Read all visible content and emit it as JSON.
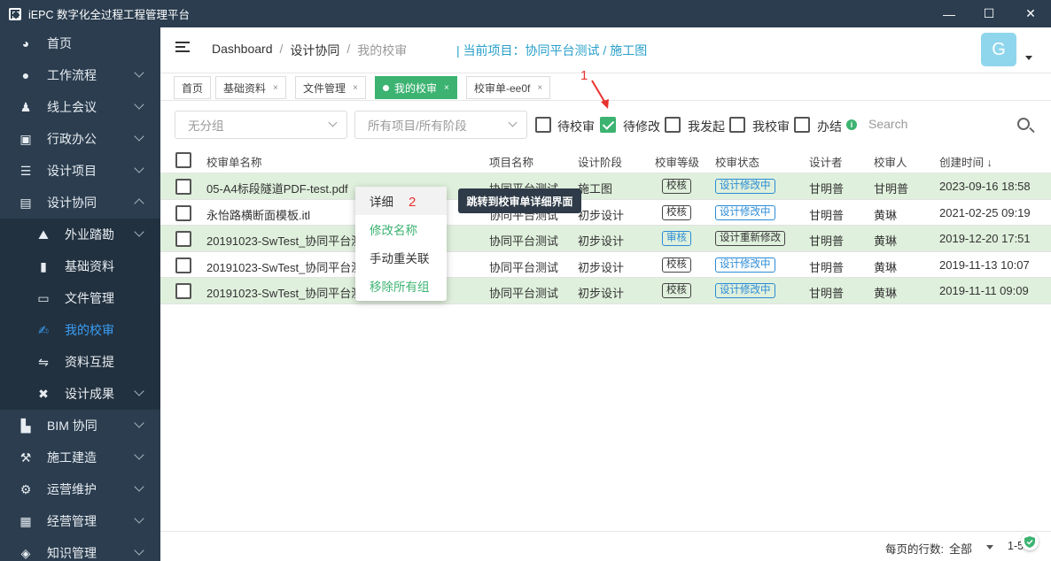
{
  "window": {
    "title": "iEPC 数字化全过程工程管理平台",
    "controls": {
      "minimize": "—",
      "maximize": "☐",
      "close": "✕"
    }
  },
  "sidebar": {
    "items": [
      {
        "label": "首页",
        "icon": "dashboard-icon"
      },
      {
        "label": "工作流程",
        "icon": "user-icon"
      },
      {
        "label": "线上会议",
        "icon": "meeting-icon"
      },
      {
        "label": "行政办公",
        "icon": "briefcase-icon"
      },
      {
        "label": "设计项目",
        "icon": "list-icon"
      },
      {
        "label": "设计协同",
        "icon": "collab-icon"
      }
    ],
    "subitems": [
      {
        "label": "外业踏勘",
        "icon": "mountain-icon"
      },
      {
        "label": "基础资料",
        "icon": "file-icon"
      },
      {
        "label": "文件管理",
        "icon": "folder-icon"
      },
      {
        "label": "我的校审",
        "icon": "edit-icon"
      },
      {
        "label": "资料互提",
        "icon": "exchange-icon"
      },
      {
        "label": "设计成果",
        "icon": "tools-icon"
      }
    ],
    "bottom_items": [
      {
        "label": "BIM 协同",
        "icon": "bim-icon"
      },
      {
        "label": "施工建造",
        "icon": "construction-icon"
      },
      {
        "label": "运营维护",
        "icon": "maintenance-icon"
      },
      {
        "label": "经营管理",
        "icon": "chart-icon"
      },
      {
        "label": "知识管理",
        "icon": "layers-icon"
      }
    ]
  },
  "header": {
    "breadcrumb": [
      "Dashboard",
      "设计协同",
      "我的校审"
    ],
    "separator": "/",
    "current_project": "| 当前项目：协同平台测试 / 施工图",
    "avatar_letter": "G"
  },
  "tabs": [
    {
      "label": "首页",
      "closable": false
    },
    {
      "label": "基础资料",
      "closable": true
    },
    {
      "label": "文件管理",
      "closable": true
    },
    {
      "label": "我的校审",
      "closable": true,
      "active": true
    },
    {
      "label": "校审单-ee0f",
      "closable": true
    }
  ],
  "tab_close": "×",
  "filters": {
    "group_select": "无分组",
    "project_select": "所有项目/所有阶段",
    "checkboxes": [
      {
        "label": "待校审",
        "checked": false
      },
      {
        "label": "待修改",
        "checked": true
      },
      {
        "label": "我发起",
        "checked": false
      },
      {
        "label": "我校审",
        "checked": false
      },
      {
        "label": "办结",
        "checked": false
      }
    ],
    "info": "i",
    "search_placeholder": "Search"
  },
  "table": {
    "headers": [
      "校审单名称",
      "项目名称",
      "设计阶段",
      "校审等级",
      "校审状态",
      "设计者",
      "校审人",
      "创建时间 ↓"
    ],
    "rows": [
      {
        "name": "05-A4标段隧道PDF-test.pdf",
        "project": "协同平台测试",
        "stage": "施工图",
        "level": "校核",
        "status": "设计修改中",
        "designer": "甘明普",
        "reviewer": "甘明普",
        "created": "2023-09-16 18:58",
        "highlight": true
      },
      {
        "name": "永怡路横断面模板.itl",
        "project": "协同平台测试",
        "stage": "初步设计",
        "level": "校核",
        "status": "设计修改中",
        "designer": "甘明普",
        "reviewer": "黄琳",
        "created": "2021-02-25 09:19",
        "highlight": false
      },
      {
        "name": "20191023-SwTest_协同平台测试 明普...",
        "project": "协同平台测试",
        "stage": "初步设计",
        "level": "审核",
        "status": "设计重新修改",
        "designer": "甘明普",
        "reviewer": "黄琳",
        "created": "2019-12-20 17:51",
        "highlight": true
      },
      {
        "name": "20191023-SwTest_协同平台测试 明普...",
        "project": "协同平台测试",
        "stage": "初步设计",
        "level": "校核",
        "status": "设计修改中",
        "designer": "甘明普",
        "reviewer": "黄琳",
        "created": "2019-11-13 10:07",
        "highlight": false
      },
      {
        "name": "20191023-SwTest_协同平台测试 明普...",
        "project": "协同平台测试",
        "stage": "初步设计",
        "level": "校核",
        "status": "设计修改中",
        "designer": "甘明普",
        "reviewer": "黄琳",
        "created": "2019-11-11 09:09",
        "highlight": true
      }
    ]
  },
  "context_menu": {
    "items": [
      "详细",
      "修改名称",
      "手动重关联",
      "移除所有组"
    ]
  },
  "tooltip": "跳转到校审单详细界面",
  "annotations": [
    "1",
    "2"
  ],
  "footer": {
    "rows_per_page_label": "每页的行数:",
    "rows_per_page_value": "全部",
    "range": "1-5"
  },
  "colors": {
    "sidebar_bg": "#2b3d4f",
    "accent_green": "#3cb371",
    "accent_blue": "#2a8bd6",
    "project_text": "#2aa0c9",
    "row_highlight": "#dff0dc",
    "annotation_red": "#e8322e"
  }
}
